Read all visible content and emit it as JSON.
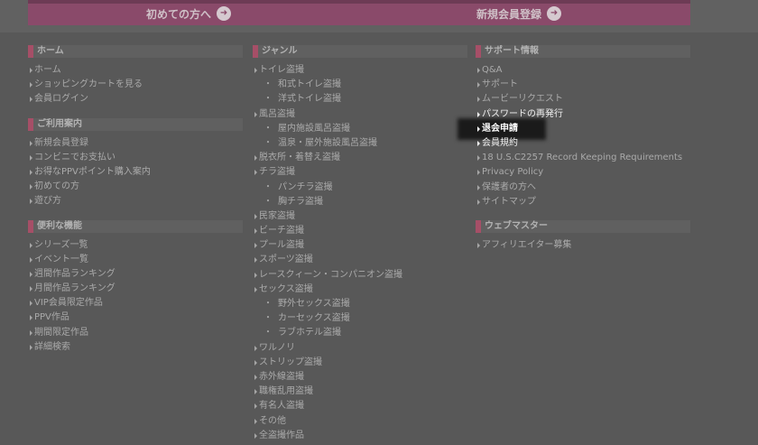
{
  "banner": {
    "left_link": "初めての方へ",
    "right_link": "新規会員登録",
    "arrow_icon": "circle-arrow-right-icon"
  },
  "col1": {
    "home": {
      "title": "ホーム",
      "items": [
        "ホーム",
        "ショッピングカートを見る",
        "会員ログイン"
      ]
    },
    "guide": {
      "title": "ご利用案内",
      "items": [
        "新規会員登録",
        "コンビニでお支払い",
        "お得なPPVポイント購入案内",
        "初めての方",
        "遊び方"
      ]
    },
    "features": {
      "title": "便利な機能",
      "items": [
        "シリーズ一覧",
        "イベント一覧",
        "週間作品ランキング",
        "月間作品ランキング",
        "VIP会員限定作品",
        "PPV作品",
        "期間限定作品",
        "詳細検索"
      ]
    }
  },
  "col2": {
    "genre": {
      "title": "ジャンル",
      "items": [
        {
          "label": "トイレ盗撮",
          "type": "main"
        },
        {
          "label": "和式トイレ盗撮",
          "type": "sub"
        },
        {
          "label": "洋式トイレ盗撮",
          "type": "sub"
        },
        {
          "label": "風呂盗撮",
          "type": "main"
        },
        {
          "label": "屋内施設風呂盗撮",
          "type": "sub"
        },
        {
          "label": "温泉・屋外施設風呂盗撮",
          "type": "sub"
        },
        {
          "label": "脱衣所・着替え盗撮",
          "type": "main"
        },
        {
          "label": "チラ盗撮",
          "type": "main"
        },
        {
          "label": "パンチラ盗撮",
          "type": "sub"
        },
        {
          "label": "胸チラ盗撮",
          "type": "sub"
        },
        {
          "label": "民家盗撮",
          "type": "main"
        },
        {
          "label": "ビーチ盗撮",
          "type": "main"
        },
        {
          "label": "プール盗撮",
          "type": "main"
        },
        {
          "label": "スポーツ盗撮",
          "type": "main"
        },
        {
          "label": "レースクィーン・コンパニオン盗撮",
          "type": "main"
        },
        {
          "label": "セックス盗撮",
          "type": "main"
        },
        {
          "label": "野外セックス盗撮",
          "type": "sub"
        },
        {
          "label": "カーセックス盗撮",
          "type": "sub"
        },
        {
          "label": "ラブホテル盗撮",
          "type": "sub"
        },
        {
          "label": "ワルノリ",
          "type": "main"
        },
        {
          "label": "ストリップ盗撮",
          "type": "main"
        },
        {
          "label": "赤外線盗撮",
          "type": "main"
        },
        {
          "label": "職権乱用盗撮",
          "type": "main"
        },
        {
          "label": "有名人盗撮",
          "type": "main"
        },
        {
          "label": "その他",
          "type": "main"
        },
        {
          "label": "全盗撮作品",
          "type": "main"
        }
      ]
    }
  },
  "col3": {
    "support": {
      "title": "サポート情報",
      "items": [
        "Q&A",
        "サポート",
        "ムービーリクエスト",
        "パスワードの再発行",
        "退会申請",
        "会員規約",
        "18 U.S.C2257 Record Keeping Requirements",
        "Privacy Policy",
        "保護者の方へ",
        "サイトマップ"
      ]
    },
    "webmaster": {
      "title": "ウェブマスター",
      "items": [
        "アフィリエイター募集"
      ]
    }
  }
}
